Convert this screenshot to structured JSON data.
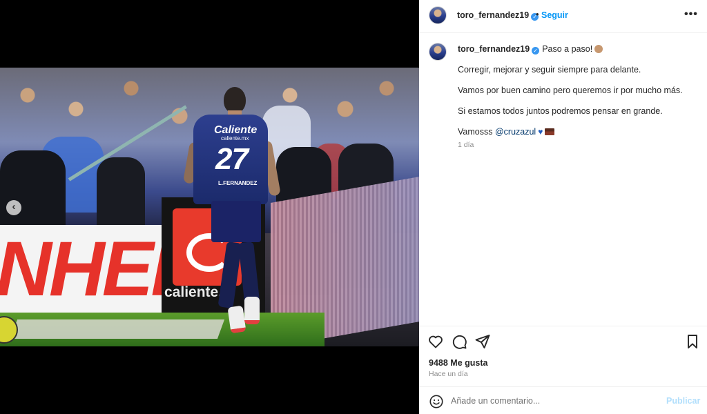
{
  "post": {
    "username": "toro_fernandez19",
    "follow_label": "Seguir",
    "more_label": "•••",
    "separator": "•"
  },
  "photo": {
    "board_text": "NHER",
    "board_brand": "caliente.p",
    "jersey_sponsor": "Caliente",
    "jersey_sponsor_sub": "caliente.mx",
    "jersey_number": "27",
    "jersey_name": "L.FERNANDEZ",
    "prev_label": "‹"
  },
  "caption": {
    "first_line": "Paso a paso!",
    "line2": "Corregir, mejorar y seguir siempre para delante.",
    "line3": "Vamos por buen camino pero queremos ir por mucho más.",
    "line4": "Si estamos todos juntos podremos pensar en grande.",
    "line5_prefix": "Vamosss",
    "mention": "@cruzazul",
    "time": "1 día"
  },
  "actions": {
    "likes": "9488 Me gusta",
    "ago": "Hace un día"
  },
  "comment": {
    "placeholder": "Añade un comentario...",
    "publish_label": "Publicar"
  },
  "icons": [
    "heart-icon",
    "comment-icon",
    "share-icon",
    "bookmark-icon",
    "emoji-icon",
    "verified-icon"
  ],
  "colors": {
    "accent": "#0095f6",
    "verified": "#3897f0",
    "publish_disabled": "#b2dffc",
    "mention": "#00376b",
    "muted": "#8e8e8e"
  }
}
